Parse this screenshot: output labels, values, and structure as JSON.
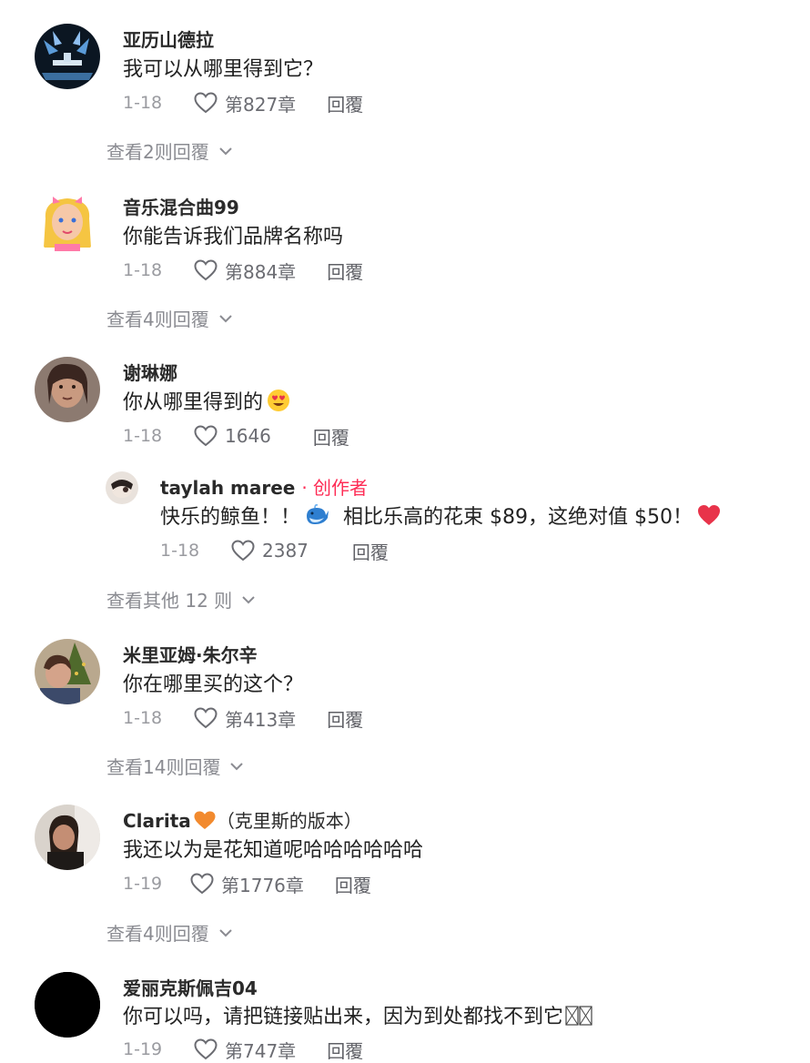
{
  "comments": [
    {
      "username": "亚历山德拉",
      "text": "我可以从哪里得到它？",
      "date": "1-18",
      "likes": "第827章",
      "reply": "回覆",
      "view_more": "查看2则回覆"
    },
    {
      "username": "音乐混合曲99",
      "text": "你能告诉我们品牌名称吗",
      "date": "1-18",
      "likes": "第884章",
      "reply": "回覆",
      "view_more": "查看4则回覆"
    },
    {
      "username": "谢琳娜",
      "text": "你从哪里得到的",
      "date": "1-18",
      "likes": "1646",
      "reply": "回覆",
      "nested": {
        "username": "taylah maree",
        "creator_tag": "· 创作者",
        "text_a": "快乐的鲸鱼！！",
        "text_b": "相比乐高的花束 $89，这绝对值 $50！",
        "date": "1-18",
        "likes": "2387",
        "reply": "回覆"
      },
      "view_more": "查看其他 12 则"
    },
    {
      "username": "米里亚姆·朱尔辛",
      "text": "你在哪里买的这个？",
      "date": "1-18",
      "likes": "第413章",
      "reply": "回覆",
      "view_more": "查看14则回覆"
    },
    {
      "username": "Clarita",
      "username_suffix": "（克里斯的版本）",
      "text": "我还以为是花知道呢哈哈哈哈哈哈",
      "date": "1-19",
      "likes": "第1776章",
      "reply": "回覆",
      "view_more": "查看4则回覆"
    },
    {
      "username": "爱丽克斯佩吉04",
      "text": "你可以吗，请把链接贴出来，因为到处都找不到它",
      "date": "1-19",
      "likes": "第747章",
      "reply": "回覆"
    }
  ],
  "colors": {
    "creator": "#fe2c55",
    "heart_emoji": "#e8334a",
    "orange_heart": "#f28a2e"
  }
}
